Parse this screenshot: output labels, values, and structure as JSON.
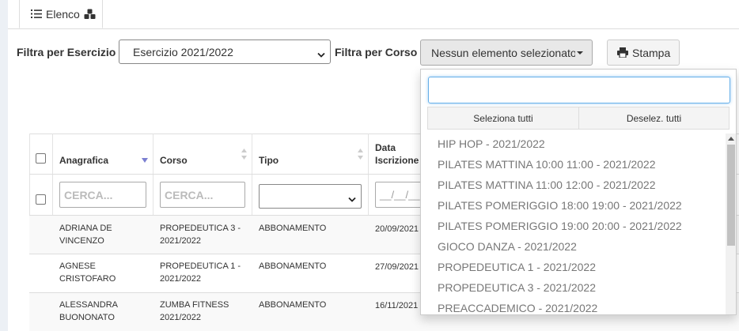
{
  "tab": {
    "label": "Elenco"
  },
  "filters": {
    "esercizio_label": "Filtra per Esercizio",
    "esercizio_value": "Esercizio 2021/2022",
    "corso_label": "Filtra per Corso",
    "corso_value": "Nessun elemento selezionato"
  },
  "print_button": {
    "label": "Stampa"
  },
  "dropdown": {
    "search_value": "",
    "select_all": "Seleziona tutti",
    "deselect_all": "Deselez. tutti",
    "items": [
      "HIP HOP - 2021/2022",
      "PILATES MATTINA 10:00 11:00 - 2021/2022",
      "PILATES MATTINA 11:00 12:00 - 2021/2022",
      "PILATES POMERIGGIO 18:00 19:00 - 2021/2022",
      "PILATES POMERIGGIO 19:00 20:00 - 2021/2022",
      "GIOCO DANZA - 2021/2022",
      "PROPEDEUTICA 1 - 2021/2022",
      "PROPEDEUTICA 3 - 2021/2022",
      "PREACCADEMICO - 2021/2022"
    ]
  },
  "table": {
    "headers": {
      "anagrafica": "Anagrafica",
      "corso": "Corso",
      "tipo": "Tipo",
      "data_1": "Data",
      "data_2": "Iscrizione"
    },
    "filters": {
      "anagrafica_placeholder": "CERCA...",
      "corso_placeholder": "CERCA...",
      "tipo_value": "",
      "data_placeholder": "__/__/__"
    },
    "rows": [
      {
        "anagrafica_1": "ADRIANA DE",
        "anagrafica_2": "VINCENZO",
        "corso_1": "PROPEDEUTICA 3 -",
        "corso_2": "2021/2022",
        "tipo": "ABBONAMENTO",
        "data": "20/09/2021"
      },
      {
        "anagrafica_1": "AGNESE",
        "anagrafica_2": "CRISTOFARO",
        "corso_1": "PROPEDEUTICA 1 -",
        "corso_2": "2021/2022",
        "tipo": "ABBONAMENTO",
        "data": "27/09/2021"
      },
      {
        "anagrafica_1": "ALESSANDRA",
        "anagrafica_2": "BUONONATO",
        "corso_1": "ZUMBA FITNESS",
        "corso_2": "2021/2022",
        "tipo": "ABBONAMENTO",
        "data": "16/11/2021"
      }
    ]
  },
  "colors": {
    "sort_active": "#7b7fd1",
    "focus": "#66afe9"
  }
}
